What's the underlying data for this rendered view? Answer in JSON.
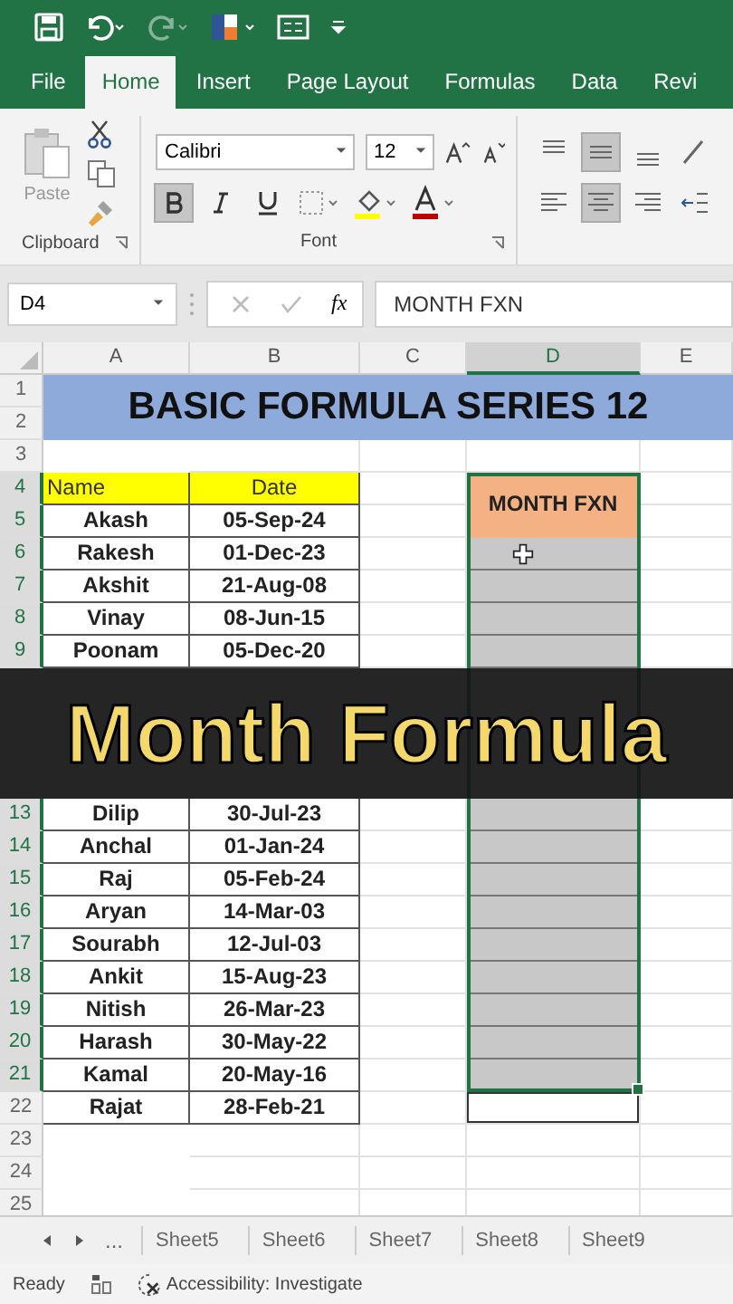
{
  "tabs": [
    {
      "label": "File",
      "selected": false
    },
    {
      "label": "Home",
      "selected": true
    },
    {
      "label": "Insert",
      "selected": false
    },
    {
      "label": "Page Layout",
      "selected": false
    },
    {
      "label": "Formulas",
      "selected": false
    },
    {
      "label": "Data",
      "selected": false
    },
    {
      "label": "Revi",
      "selected": false
    }
  ],
  "ribbon": {
    "paste_label": "Paste",
    "font_name": "Calibri",
    "font_size": "12",
    "bold": true,
    "middle_aligned": true,
    "center_aligned": true,
    "groups": [
      "Clipboard",
      "Font"
    ]
  },
  "formula_bar": {
    "name_box": "D4",
    "fx": "fx",
    "formula": "MONTH FXN"
  },
  "columns": [
    {
      "label": "A",
      "selected": false
    },
    {
      "label": "B",
      "selected": false
    },
    {
      "label": "C",
      "selected": false
    },
    {
      "label": "D",
      "selected": true
    },
    {
      "label": "E",
      "selected": false
    }
  ],
  "sheet": {
    "title": "BASIC FORMULA SERIES 12",
    "d_header": "MONTH FXN"
  },
  "rows_top": [
    {
      "number": "1",
      "kind": "title",
      "selected": false
    },
    {
      "number": "2",
      "kind": "title",
      "selected": false
    },
    {
      "number": "3",
      "kind": "empty",
      "selected": false,
      "d_header": false,
      "d_selected": false,
      "d_outlined": false
    },
    {
      "number": "4",
      "kind": "table_head",
      "name": "Name",
      "date": "Date",
      "selected": true,
      "d_header": true,
      "d_selected": false,
      "d_outlined": false
    },
    {
      "number": "5",
      "kind": "data",
      "name": "Akash",
      "date": "05-Sep-24",
      "selected": true,
      "d_header": true,
      "d_selected": false,
      "d_outlined": false
    },
    {
      "number": "6",
      "kind": "data",
      "name": "Rakesh",
      "date": "01-Dec-23",
      "selected": true,
      "d_header": false,
      "d_selected": true,
      "d_outlined": false,
      "cursor": true
    },
    {
      "number": "7",
      "kind": "data",
      "name": "Akshit",
      "date": "21-Aug-08",
      "selected": true,
      "d_header": false,
      "d_selected": true,
      "d_outlined": false
    },
    {
      "number": "8",
      "kind": "data",
      "name": "Vinay",
      "date": "08-Jun-15",
      "selected": true,
      "d_header": false,
      "d_selected": true,
      "d_outlined": false
    },
    {
      "number": "9",
      "kind": "data",
      "name": "Poonam",
      "date": "05-Dec-20",
      "selected": true,
      "d_header": false,
      "d_selected": true,
      "d_outlined": false
    }
  ],
  "banner": {
    "text": "Month Formula"
  },
  "rows_bottom": [
    {
      "number": "13",
      "kind": "data",
      "name": "Dilip",
      "date": "30-Jul-23",
      "selected": true,
      "d_header": false,
      "d_selected": true,
      "d_outlined": false
    },
    {
      "number": "14",
      "kind": "data",
      "name": "Anchal",
      "date": "01-Jan-24",
      "selected": true,
      "d_header": false,
      "d_selected": true,
      "d_outlined": false
    },
    {
      "number": "15",
      "kind": "data",
      "name": "Raj",
      "date": "05-Feb-24",
      "selected": true,
      "d_header": false,
      "d_selected": true,
      "d_outlined": false
    },
    {
      "number": "16",
      "kind": "data",
      "name": "Aryan",
      "date": "14-Mar-03",
      "selected": true,
      "d_header": false,
      "d_selected": true,
      "d_outlined": false
    },
    {
      "number": "17",
      "kind": "data",
      "name": "Sourabh",
      "date": "12-Jul-03",
      "selected": true,
      "d_header": false,
      "d_selected": true,
      "d_outlined": false
    },
    {
      "number": "18",
      "kind": "data",
      "name": "Ankit",
      "date": "15-Aug-23",
      "selected": true,
      "d_header": false,
      "d_selected": true,
      "d_outlined": false
    },
    {
      "number": "19",
      "kind": "data",
      "name": "Nitish",
      "date": "26-Mar-23",
      "selected": true,
      "d_header": false,
      "d_selected": true,
      "d_outlined": false
    },
    {
      "number": "20",
      "kind": "data",
      "name": "Harash",
      "date": "30-May-22",
      "selected": true,
      "d_header": false,
      "d_selected": true,
      "d_outlined": false
    },
    {
      "number": "21",
      "kind": "data",
      "name": "Kamal",
      "date": "20-May-16",
      "selected": true,
      "d_header": false,
      "d_selected": true,
      "d_outlined": false
    },
    {
      "number": "22",
      "kind": "data",
      "name": "Rajat",
      "date": "28-Feb-21",
      "selected": false,
      "d_header": false,
      "d_selected": false,
      "d_outlined": true
    },
    {
      "number": "23",
      "kind": "empty",
      "selected": false,
      "d_header": false,
      "d_selected": false,
      "d_outlined": false
    },
    {
      "number": "24",
      "kind": "empty",
      "selected": false,
      "d_header": false,
      "d_selected": false,
      "d_outlined": false
    },
    {
      "number": "25",
      "kind": "empty",
      "selected": false,
      "d_header": false,
      "d_selected": false,
      "d_outlined": false
    }
  ],
  "sheet_tabs": {
    "more": "...",
    "tabs": [
      {
        "label": "Sheet5",
        "selected": false
      },
      {
        "label": "Sheet6",
        "selected": false
      },
      {
        "label": "Sheet7",
        "selected": false
      },
      {
        "label": "Sheet8",
        "selected": false
      },
      {
        "label": "Sheet9",
        "selected": false
      }
    ]
  },
  "status_bar": {
    "ready": "Ready",
    "accessibility": "Accessibility: Investigate"
  }
}
